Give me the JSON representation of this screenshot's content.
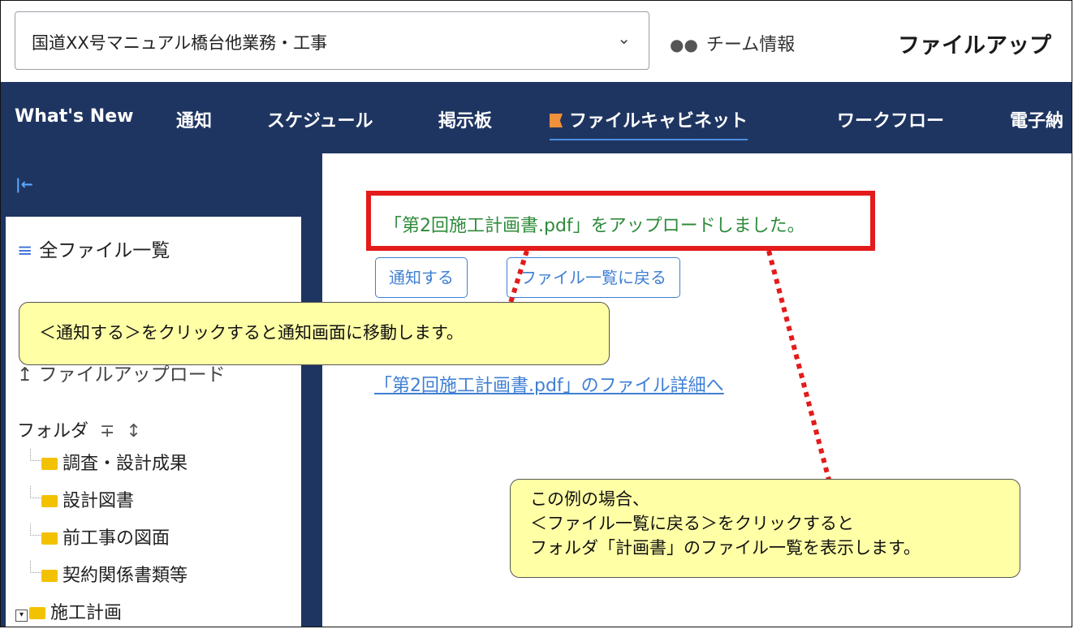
{
  "header": {
    "project_name": "国道XX号マニュアル橋台他業務・工事",
    "team_info": "チーム情報",
    "page_title": "ファイルアップ"
  },
  "nav": {
    "items": [
      "What's New",
      "通知",
      "スケジュール",
      "掲示板",
      "ファイルキャビネット",
      "ワークフロー",
      "電子納"
    ],
    "active": "ファイルキャビネット"
  },
  "sidebar": {
    "all_files": "全ファイル一覧",
    "upload": "ファイルアップロード",
    "folder_header": "フォルダ",
    "folders": [
      "調査・設計成果",
      "設計図書",
      "前工事の図面",
      "契約関係書類等",
      "施工計画"
    ]
  },
  "main": {
    "success_message": "「第2回施工計画書.pdf」をアップロードしました。",
    "notify_button": "通知する",
    "back_button": "ファイル一覧に戻る",
    "detail_link": "「第2回施工計画書.pdf」のファイル詳細へ"
  },
  "annotations": {
    "callout1": "＜通知する＞をクリックすると通知画面に移動します。",
    "callout2_line1": "この例の場合、",
    "callout2_line2": "＜ファイル一覧に戻る＞をクリックすると",
    "callout2_line3": "フォルダ「計画書」のファイル一覧を表示します。"
  },
  "colors": {
    "nav_bg": "#1f3561",
    "success_text": "#2e8b3a",
    "highlight": "#e31b1b",
    "callout_bg": "#ffffa6",
    "link": "#3f7fd4",
    "folder": "#f2c200",
    "flag": "#f0913b"
  }
}
